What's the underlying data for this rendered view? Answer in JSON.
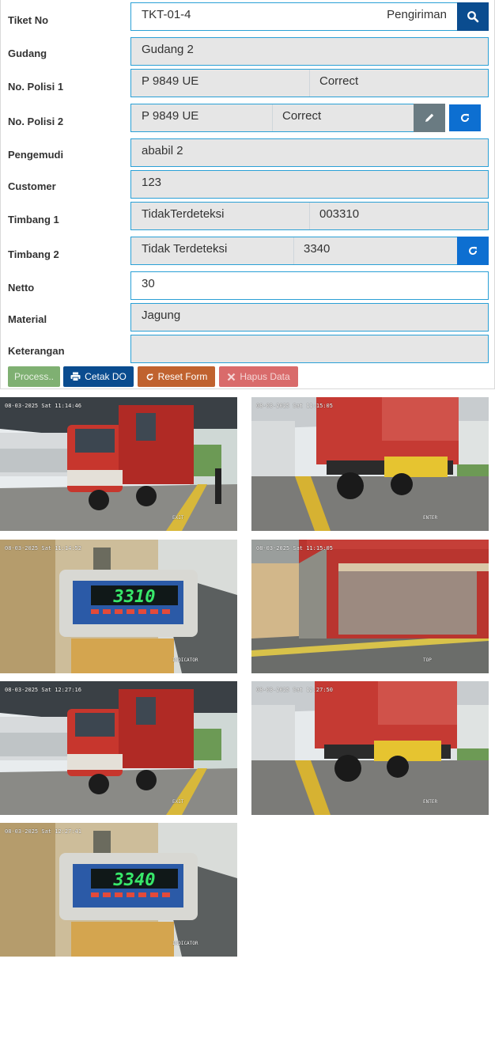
{
  "form": {
    "tiket": {
      "label": "Tiket No",
      "value": "TKT-01-4",
      "type": "Pengiriman"
    },
    "gudang": {
      "label": "Gudang",
      "value": "Gudang 2"
    },
    "polisi1": {
      "label": "No. Polisi 1",
      "plate": "P 9849 UE",
      "status": "Correct"
    },
    "polisi2": {
      "label": "No. Polisi 2",
      "plate": "P 9849 UE",
      "status": "Correct"
    },
    "pengemudi": {
      "label": "Pengemudi",
      "value": "ababil 2"
    },
    "customer": {
      "label": "Customer",
      "value": "123"
    },
    "timbang1": {
      "label": "Timbang 1",
      "detect": "TidakTerdeteksi",
      "weight": "003310"
    },
    "timbang2": {
      "label": "Timbang 2",
      "detect": "Tidak Terdeteksi",
      "weight": "3340"
    },
    "netto": {
      "label": "Netto",
      "value": "30"
    },
    "material": {
      "label": "Material",
      "value": "Jagung"
    },
    "keterangan": {
      "label": "Keterangan",
      "value": ""
    }
  },
  "actions": {
    "process": "Process..",
    "cetak": "Cetak DO",
    "reset": "Reset Form",
    "hapus": "Hapus Data"
  },
  "icons": {
    "search": "search-icon",
    "edit": "pencil-icon",
    "refresh": "refresh-icon",
    "print": "printer-icon",
    "close": "close-icon"
  },
  "colors": {
    "accent": "#0d6fd1",
    "navy": "#0a4c8f",
    "field_border": "#2aa0d6",
    "process": "#7fb072",
    "reset": "#c0622f",
    "hapus": "#d96b6b"
  },
  "snapshots": [
    {
      "timestamp": "08-03-2025 Sat 11:14:46",
      "camera": "EXIT"
    },
    {
      "timestamp": "08-03-2025 Sat 11:15:05",
      "camera": "ENTER"
    },
    {
      "timestamp": "08-03-2025 Sat 11:14:52",
      "camera": "INDICATOR",
      "display": "3310"
    },
    {
      "timestamp": "08-03-2025 Sat 11:15:05",
      "camera": "TOP"
    },
    {
      "timestamp": "08-03-2025 Sat 12:27:16",
      "camera": "EXIT"
    },
    {
      "timestamp": "08-03-2025 Sat 12:27:50",
      "camera": "ENTER"
    },
    {
      "timestamp": "08-03-2025 Sat 12:27:41",
      "camera": "INDICATOR",
      "display": "3340"
    }
  ]
}
